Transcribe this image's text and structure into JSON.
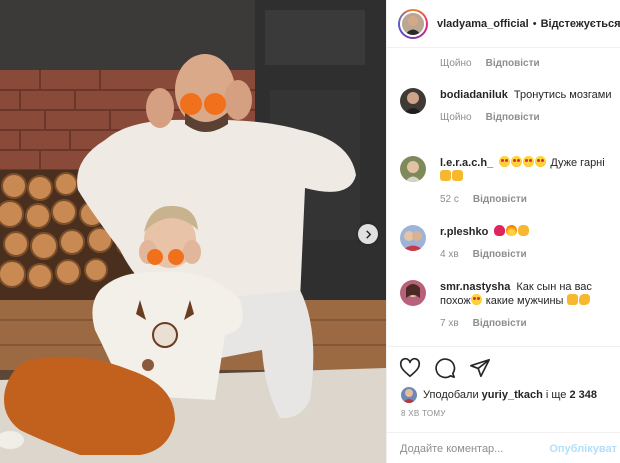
{
  "post": {
    "username": "vladyama_official",
    "separator": "•",
    "follow_status": "Відстежується"
  },
  "comments_meta_top": {
    "time": "Щойно",
    "reply": "Відповісти"
  },
  "comments": [
    {
      "username": "bodiadaniluk",
      "text": "Тронутись мозгами",
      "time": "Щойно",
      "reply": "Відповісти",
      "emoji": []
    },
    {
      "username": "l.e.r.a.c.h_",
      "text": "Дуже гарні",
      "time": "52 с",
      "reply": "Відповісти",
      "emoji": [
        "heart-eyes",
        "heart-eyes",
        "heart-eyes",
        "heart-eyes",
        "thumbs-up",
        "thumbs-up"
      ]
    },
    {
      "username": "r.pleshko",
      "text": "",
      "time": "4 хв",
      "reply": "Відповісти",
      "emoji": [
        "heart",
        "fire",
        "clap"
      ]
    },
    {
      "username": "smr.nastysha",
      "text_before": "Как сын на вас похож",
      "text_after": " какие мужчины",
      "time": "7 хв",
      "reply": "Відповісти",
      "emoji": [
        "heart-eyes",
        "thumbs-up",
        "muscle"
      ]
    }
  ],
  "actions": {
    "like_icon": "heart-outline-icon",
    "comment_icon": "comment-bubble-icon",
    "share_icon": "paper-plane-icon"
  },
  "likes": {
    "prefix": "Уподобали",
    "user": "yuriy_tkach",
    "middle": "і ще",
    "count": "2 348"
  },
  "timestamp": "8 хв тому",
  "add_comment": {
    "placeholder": "Додайте коментар...",
    "publish": "Опублікуват"
  },
  "colors": {
    "link_disabled": "#b2dffc",
    "muted": "#8e8e8e",
    "text": "#262626",
    "divider": "#efefef"
  }
}
